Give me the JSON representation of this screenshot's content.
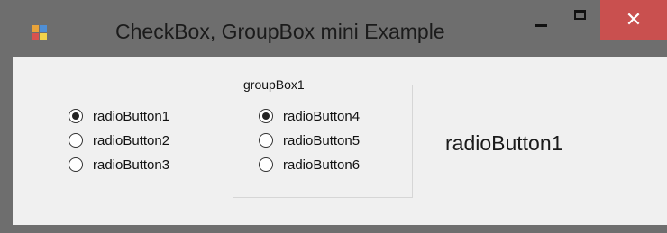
{
  "window": {
    "title": "CheckBox, GroupBox mini Example",
    "close_glyph": "✕"
  },
  "colors": {
    "frame": "#6e6e6e",
    "client": "#f0f0f0",
    "close_button": "#c9504f"
  },
  "left_radios": [
    {
      "label": "radioButton1",
      "checked": true
    },
    {
      "label": "radioButton2",
      "checked": false
    },
    {
      "label": "radioButton3",
      "checked": false
    }
  ],
  "group_box": {
    "title": "groupBox1",
    "radios": [
      {
        "label": "radioButton4",
        "checked": true
      },
      {
        "label": "radioButton5",
        "checked": false
      },
      {
        "label": "radioButton6",
        "checked": false
      }
    ]
  },
  "result_label": "radioButton1"
}
